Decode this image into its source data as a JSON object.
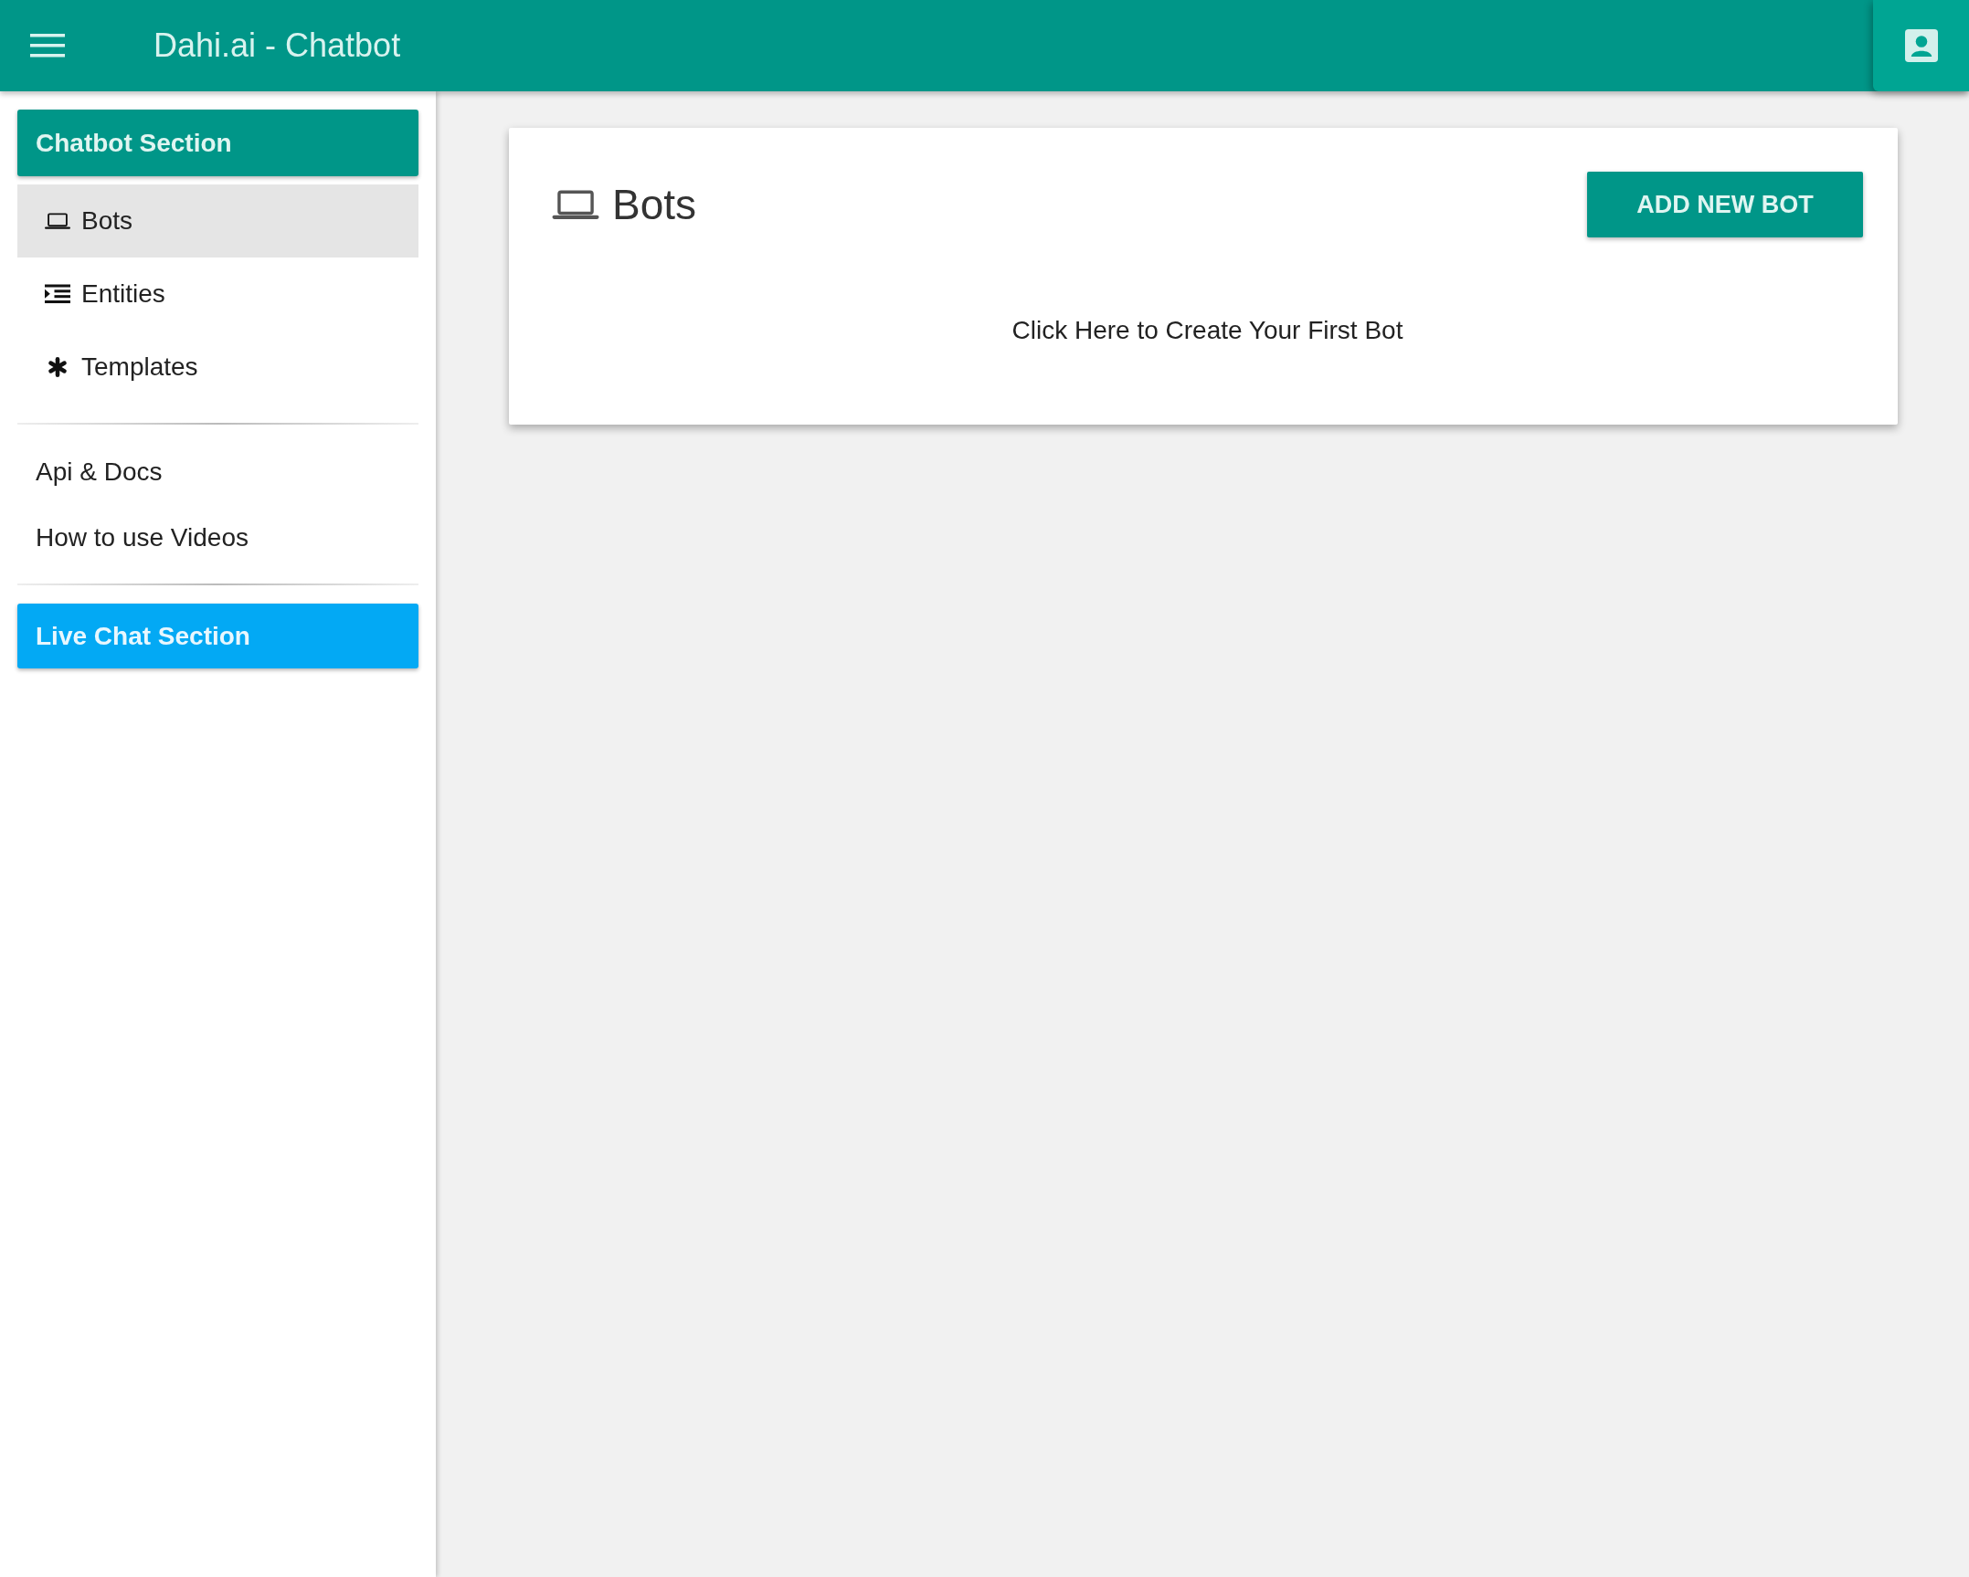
{
  "app_bar": {
    "title": "Dahi.ai - Chatbot"
  },
  "sidebar": {
    "section_header": "Chatbot Section",
    "items": [
      {
        "label": "Bots",
        "selected": true
      },
      {
        "label": "Entities",
        "selected": false
      },
      {
        "label": "Templates",
        "selected": false
      }
    ],
    "links": [
      "Api & Docs",
      "How to use Videos"
    ],
    "live_chat_button": "Live Chat Section"
  },
  "card": {
    "title": "Bots",
    "add_button": "ADD NEW BOT",
    "empty_message": "Click Here to Create Your First Bot"
  }
}
